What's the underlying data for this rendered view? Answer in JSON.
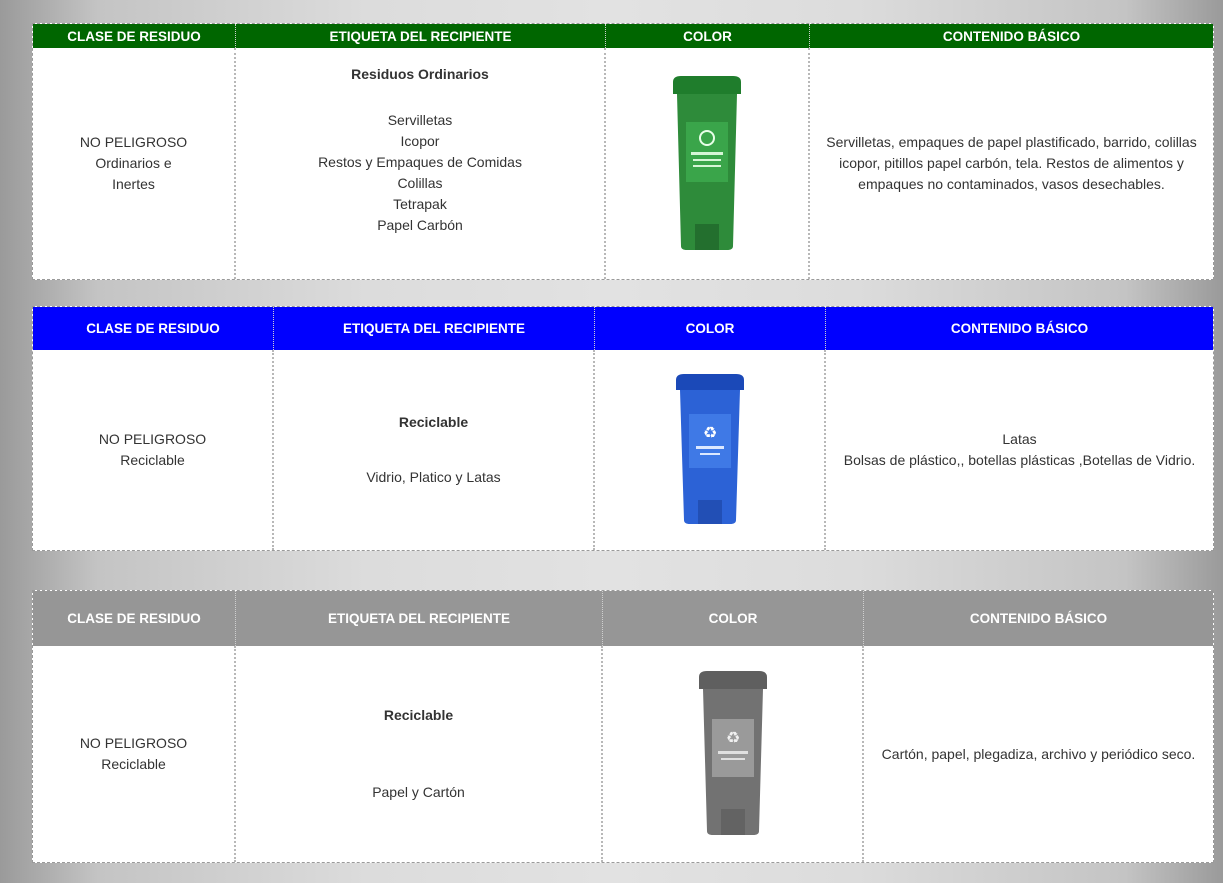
{
  "colors": {
    "green": "#006600",
    "blue": "#0000ff",
    "gray": "#969696"
  },
  "tables": [
    {
      "header": {
        "clase": "CLASE DE RESIDUO",
        "etiqueta": "ETIQUETA DEL RECIPIENTE",
        "color": "COLOR",
        "contenido": "CONTENIDO BÁSICO"
      },
      "clase_line1": "NO PELIGROSO",
      "clase_line2": "Ordinarios e",
      "clase_line3": "Inertes",
      "etiqueta_title": "Residuos Ordinarios",
      "etiqueta_items": [
        "Servilletas",
        "Icopor",
        "Restos y Empaques de Comidas",
        "Colillas",
        "Tetrapak",
        "Papel Carbón"
      ],
      "bin_icon": "green-recycle-bin-icon",
      "contenido": "Servilletas, empaques de papel plastificado, barrido, colillas icopor, pitillos papel carbón, tela. Restos de alimentos y empaques no contaminados, vasos desechables."
    },
    {
      "header": {
        "clase": "CLASE DE RESIDUO",
        "etiqueta": "ETIQUETA DEL RECIPIENTE",
        "color": "COLOR",
        "contenido": "CONTENIDO BÁSICO"
      },
      "clase_line1": "NO PELIGROSO",
      "clase_line2": "Reciclable",
      "etiqueta_title": "Reciclable",
      "etiqueta_text": "Vidrio, Platico y Latas",
      "bin_icon": "blue-recycle-bin-icon",
      "contenido_line1": "Latas",
      "contenido_line2": "Bolsas de plástico,, botellas plásticas ,Botellas de Vidrio."
    },
    {
      "header": {
        "clase": "CLASE DE RESIDUO",
        "etiqueta": "ETIQUETA DEL RECIPIENTE",
        "color": "COLOR",
        "contenido": "CONTENIDO BÁSICO"
      },
      "clase_line1": "NO PELIGROSO",
      "clase_line2": "Reciclable",
      "etiqueta_title": "Reciclable",
      "etiqueta_text": "Papel y Cartón",
      "bin_icon": "gray-recycle-bin-icon",
      "contenido": "Cartón, papel, plegadiza, archivo y periódico seco."
    }
  ]
}
